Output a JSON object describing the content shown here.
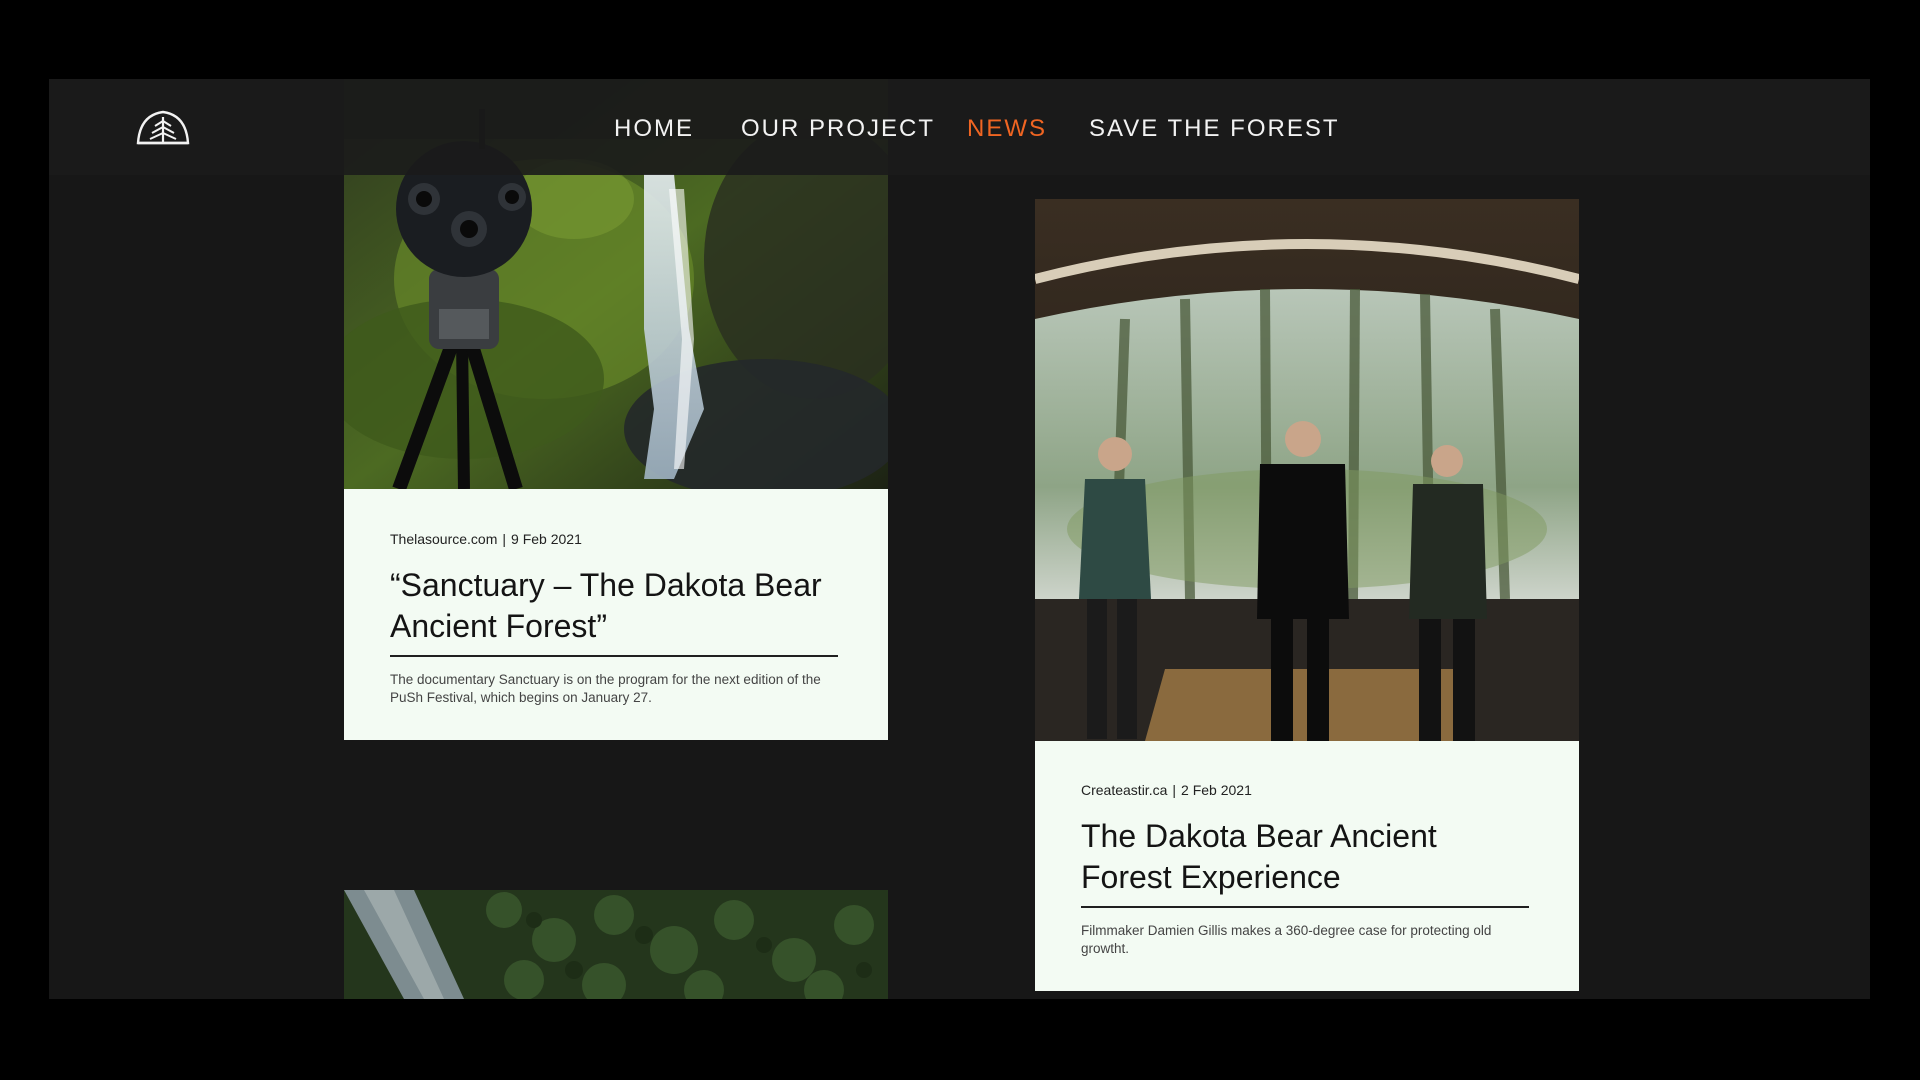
{
  "nav": {
    "items": [
      {
        "label": "HOME",
        "active": false
      },
      {
        "label": "OUR PROJECT",
        "active": false
      },
      {
        "label": "NEWS",
        "active": true
      },
      {
        "label": "SAVE THE FOREST",
        "active": false
      }
    ]
  },
  "colors": {
    "accent": "#f06522",
    "background": "#171717",
    "card_bg": "#f3fbf3"
  },
  "articles": [
    {
      "source": "Thelasource.com",
      "date": "9 Feb 2021",
      "title": "“Sanctuary – The Dakota Bear Ancient Forest”",
      "excerpt": "The documentary Sanctuary is on the program for the next edition of the PuSh Festival, which begins on January 27.",
      "image": "camera-waterfall-photo"
    },
    {
      "source": "Createastir.ca",
      "date": "2 Feb 2021",
      "title": "The Dakota Bear Ancient Forest Experience",
      "excerpt": "Filmmaker Damien Gillis makes a 360-degree case for protecting old growtht.",
      "image": "dome-projection-photo"
    },
    {
      "image": "aerial-forest-river-photo"
    }
  ],
  "icons": {
    "logo": "tree-logo-icon"
  }
}
